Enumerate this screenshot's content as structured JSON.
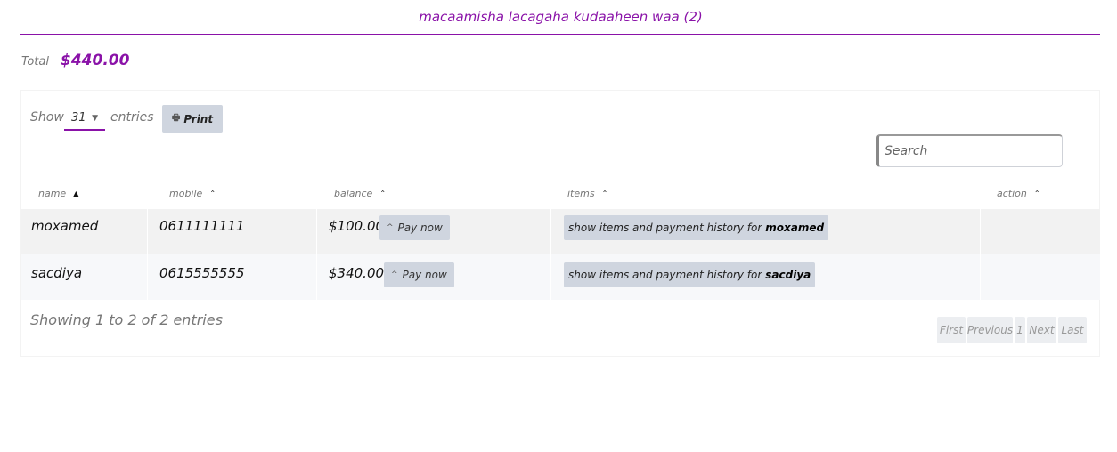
{
  "header": {
    "title": "macaamisha lacagaha kudaaheen waa (2)"
  },
  "summary": {
    "total_label": "Total",
    "total_value": "$440.00"
  },
  "controls": {
    "show_label": "Show",
    "entries_value": "31",
    "entries_label": "entries",
    "print_label": "Print",
    "search_placeholder": "Search"
  },
  "table": {
    "columns": [
      "name",
      "mobile",
      "balance",
      "items",
      "action"
    ],
    "rows": [
      {
        "name": "moxamed",
        "mobile": "0611111111",
        "balance": "$100.00",
        "pay_label": "Pay now",
        "items_text": "show items and payment history for",
        "items_name": "moxamed"
      },
      {
        "name": "sacdiya",
        "mobile": "0615555555",
        "balance": "$340.00",
        "pay_label": "Pay now",
        "items_text": "show items and payment history for",
        "items_name": "sacdiya"
      }
    ]
  },
  "footer": {
    "showing_text": "Showing 1 to 2 of 2 entries",
    "pager": {
      "first": "First",
      "previous": "Previous",
      "page": "1",
      "next": "Next",
      "last": "Last"
    }
  },
  "colors": {
    "accent": "#8a12a8",
    "button_bg": "#cfd5df"
  },
  "icons": {
    "print": "printer-icon",
    "sort": "sort-up-icon",
    "dropdown": "caret-down-icon",
    "pay": "chevron-up-icon"
  }
}
